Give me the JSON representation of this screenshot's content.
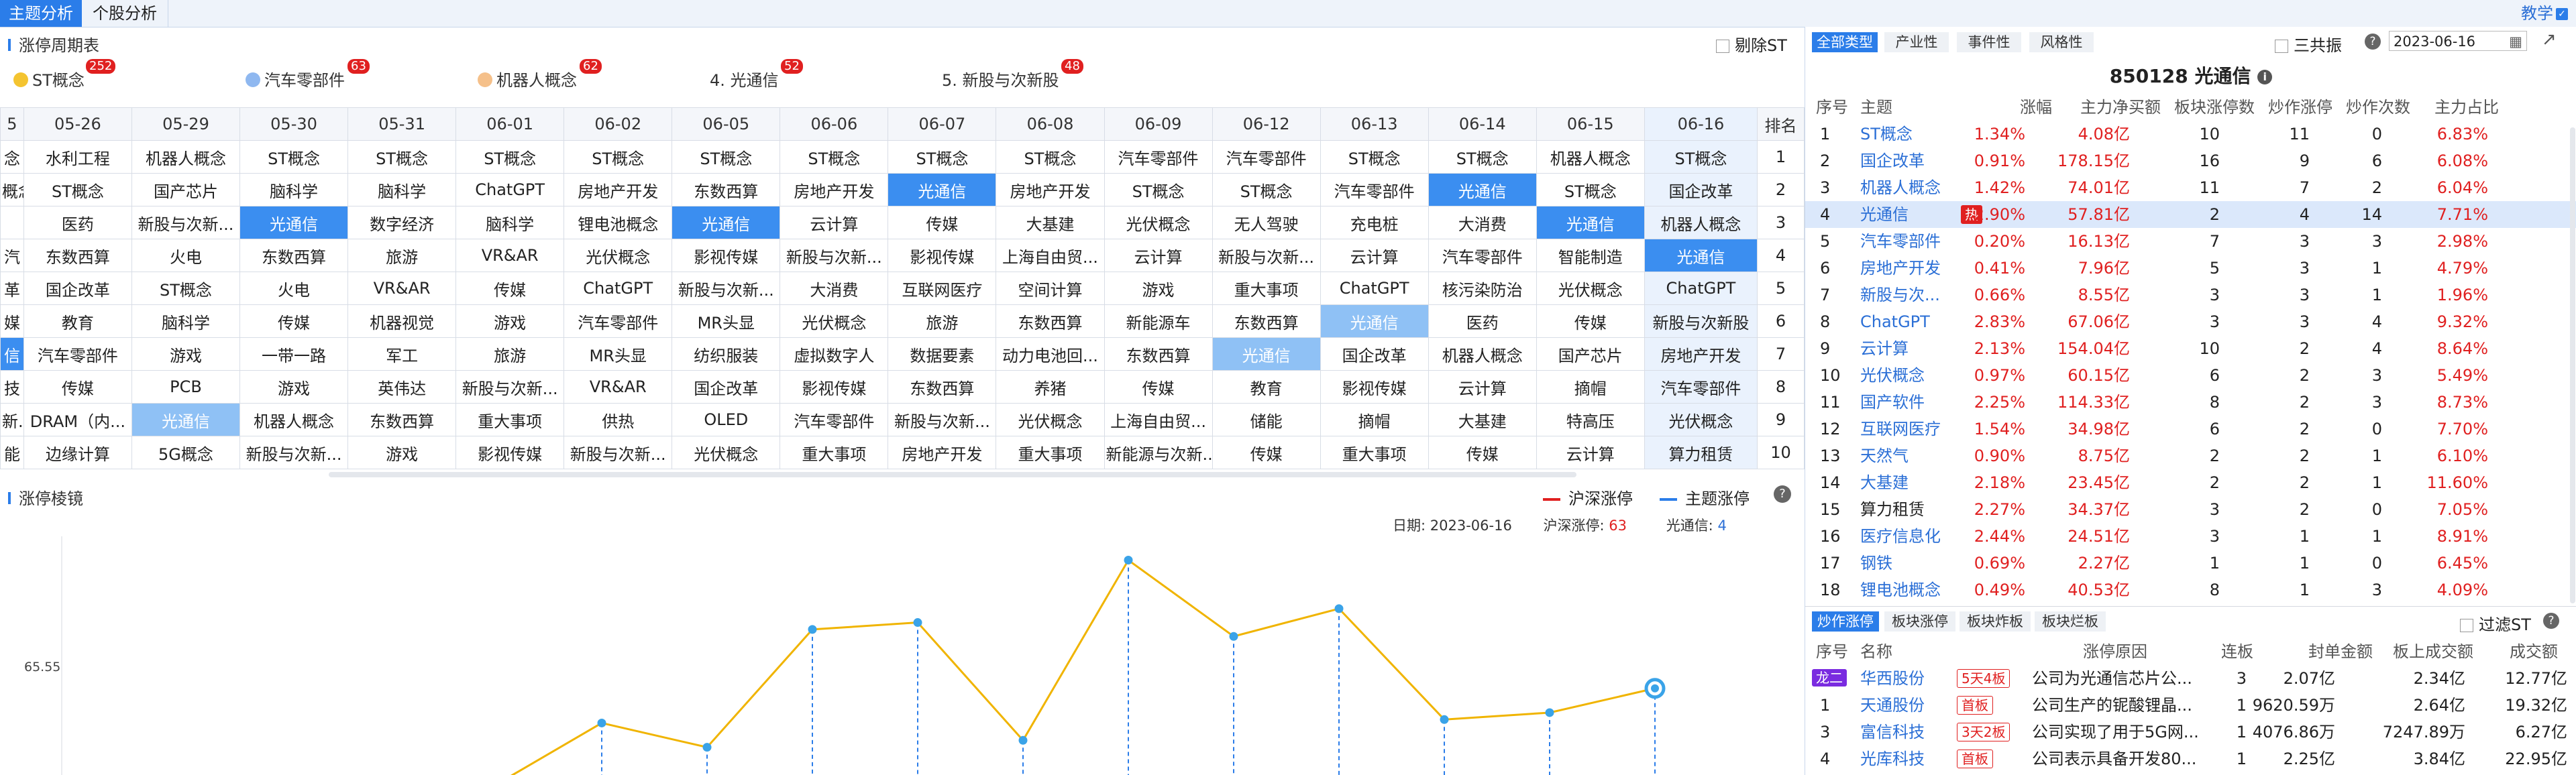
{
  "top_tabs": [
    "主题分析",
    "个股分析"
  ],
  "teach_label": "教学",
  "cycle_table": {
    "title": "涨停周期表",
    "exclude_st_label": "剔除ST",
    "legend": [
      {
        "label": "ST概念",
        "count": "252",
        "dot": "#f4c430"
      },
      {
        "label": "汽车零部件",
        "count": "63",
        "dot": "#8fb8f0"
      },
      {
        "label": "机器人概念",
        "count": "62",
        "dot": "#f5c08a"
      },
      {
        "label": "4. 光通信",
        "count": "52"
      },
      {
        "label": "5. 新股与次新股",
        "count": "48"
      }
    ],
    "dates": [
      "5",
      "05-26",
      "05-29",
      "05-30",
      "05-31",
      "06-01",
      "06-02",
      "06-05",
      "06-06",
      "06-07",
      "06-08",
      "06-09",
      "06-12",
      "06-13",
      "06-14",
      "06-15",
      "06-16"
    ],
    "rank_header": "排名",
    "rows": [
      [
        "念",
        "水利工程",
        "机器人概念",
        "ST概念",
        "ST概念",
        "ST概念",
        "ST概念",
        "ST概念",
        "ST概念",
        "ST概念",
        "ST概念",
        "汽车零部件",
        "汽车零部件",
        "ST概念",
        "ST概念",
        "机器人概念",
        "ST概念"
      ],
      [
        "概念",
        "ST概念",
        "国产芯片",
        "脑科学",
        "脑科学",
        "ChatGPT",
        "房地产开发",
        "东数西算",
        "房地产开发",
        "光通信",
        "房地产开发",
        "ST概念",
        "ST概念",
        "汽车零部件",
        "光通信",
        "ST概念",
        "国企改革"
      ],
      [
        "",
        "医药",
        "新股与次新...",
        "光通信",
        "数字经济",
        "脑科学",
        "锂电池概念",
        "光通信",
        "云计算",
        "传媒",
        "大基建",
        "光伏概念",
        "无人驾驶",
        "充电桩",
        "大消费",
        "光通信",
        "机器人概念"
      ],
      [
        "汽",
        "东数西算",
        "火电",
        "东数西算",
        "旅游",
        "VR&AR",
        "光伏概念",
        "影视传媒",
        "新股与次新...",
        "影视传媒",
        "上海自由贸...",
        "云计算",
        "新股与次新...",
        "云计算",
        "汽车零部件",
        "智能制造",
        "光通信"
      ],
      [
        "革",
        "国企改革",
        "ST概念",
        "火电",
        "VR&AR",
        "传媒",
        "ChatGPT",
        "新股与次新...",
        "大消费",
        "互联网医疗",
        "空间计算",
        "游戏",
        "重大事项",
        "ChatGPT",
        "核污染防治",
        "光伏概念",
        "ChatGPT"
      ],
      [
        "媒",
        "教育",
        "脑科学",
        "传媒",
        "机器视觉",
        "游戏",
        "汽车零部件",
        "MR头显",
        "光伏概念",
        "旅游",
        "东数西算",
        "新能源车",
        "东数西算",
        "光通信",
        "医药",
        "传媒",
        "新股与次新股"
      ],
      [
        "信",
        "汽车零部件",
        "游戏",
        "一带一路",
        "军工",
        "旅游",
        "MR头显",
        "纺织服装",
        "虚拟数字人",
        "数据要素",
        "动力电池回...",
        "东数西算",
        "光通信",
        "国企改革",
        "机器人概念",
        "国产芯片",
        "房地产开发"
      ],
      [
        "技",
        "传媒",
        "PCB",
        "游戏",
        "英伟达",
        "新股与次新...",
        "VR&AR",
        "国企改革",
        "影视传媒",
        "东数西算",
        "养猪",
        "传媒",
        "教育",
        "影视传媒",
        "云计算",
        "摘帽",
        "汽车零部件"
      ],
      [
        "新...",
        "DRAM（内...",
        "光通信",
        "机器人概念",
        "东数西算",
        "重大事项",
        "供热",
        "OLED",
        "汽车零部件",
        "新股与次新...",
        "光伏概念",
        "上海自由贸...",
        "储能",
        "摘帽",
        "大基建",
        "特高压",
        "光伏概念"
      ],
      [
        "能",
        "边缘计算",
        "5G概念",
        "新股与次新...",
        "游戏",
        "影视传媒",
        "新股与次新...",
        "光伏概念",
        "重大事项",
        "房地产开发",
        "重大事项",
        "新能源与次新...",
        "传媒",
        "重大事项",
        "传媒",
        "云计算",
        "算力租赁"
      ]
    ],
    "ranks": [
      "1",
      "2",
      "3",
      "4",
      "5",
      "6",
      "7",
      "8",
      "9",
      "10"
    ],
    "highlight_color": "#3b8ef0",
    "highlight_light_color": "#8fc1f5"
  },
  "limit_chart": {
    "title": "涨停棱镜",
    "legend_hs": "沪深涨停",
    "legend_theme": "主题涨停",
    "date_label": "日期:",
    "date_value": "2023-06-16",
    "hs_label": "沪深涨停:",
    "hs_value": "63",
    "theme_label": "光通信:",
    "theme_value": "4",
    "y_tick": "65.55",
    "hs_color": "#e02020",
    "theme_color": "#2b7de9",
    "line_color": "#f0b400"
  },
  "chart_data": {
    "type": "line",
    "title": "",
    "x": [
      "05-26",
      "05-29",
      "05-30",
      "05-31",
      "06-01",
      "06-02",
      "06-05",
      "06-06",
      "06-07",
      "06-08",
      "06-09",
      "06-12",
      "06-13",
      "06-14",
      "06-15",
      "06-16"
    ],
    "series": [
      {
        "name": "主题涨停",
        "values": [
          null,
          null,
          null,
          null,
          null,
          null,
          55,
          48,
          82,
          84,
          50,
          102,
          80,
          88,
          56,
          58,
          65
        ]
      }
    ],
    "ylabel": "",
    "visible_tick": 65.55
  },
  "right_panel": {
    "tabs": [
      "全部类型",
      "产业性",
      "事件性",
      "风格性"
    ],
    "sanggong_label": "三共振",
    "date_value": "2023-06-16",
    "header_code": "850128 光通信",
    "columns": [
      "序号",
      "主题",
      "涨幅",
      "主力净买额",
      "板块涨停数",
      "炒作涨停",
      "炒作次数",
      "主力占比"
    ],
    "rows": [
      {
        "n": "1",
        "name": "ST概念",
        "pct": "1.34%",
        "buy": "4.08亿",
        "lim": "10",
        "hot": "11",
        "times": "0",
        "ratio": "6.83%"
      },
      {
        "n": "2",
        "name": "国企改革",
        "pct": "0.91%",
        "buy": "178.15亿",
        "lim": "16",
        "hot": "9",
        "times": "6",
        "ratio": "6.08%"
      },
      {
        "n": "3",
        "name": "机器人概念",
        "pct": "1.42%",
        "buy": "74.01亿",
        "lim": "11",
        "hot": "7",
        "times": "2",
        "ratio": "6.04%"
      },
      {
        "n": "4",
        "name": "光通信",
        "pct": "2.90%",
        "buy": "57.81亿",
        "lim": "2",
        "hot": "4",
        "times": "14",
        "ratio": "7.71%",
        "tag": "热"
      },
      {
        "n": "5",
        "name": "汽车零部件",
        "pct": "0.20%",
        "buy": "16.13亿",
        "lim": "7",
        "hot": "3",
        "times": "3",
        "ratio": "2.98%"
      },
      {
        "n": "6",
        "name": "房地产开发",
        "pct": "0.41%",
        "buy": "7.96亿",
        "lim": "5",
        "hot": "3",
        "times": "1",
        "ratio": "4.79%"
      },
      {
        "n": "7",
        "name": "新股与次...",
        "pct": "0.66%",
        "buy": "8.55亿",
        "lim": "3",
        "hot": "3",
        "times": "1",
        "ratio": "1.96%"
      },
      {
        "n": "8",
        "name": "ChatGPT",
        "pct": "2.83%",
        "buy": "67.06亿",
        "lim": "3",
        "hot": "3",
        "times": "4",
        "ratio": "9.32%"
      },
      {
        "n": "9",
        "name": "云计算",
        "pct": "2.13%",
        "buy": "154.04亿",
        "lim": "10",
        "hot": "2",
        "times": "4",
        "ratio": "8.64%"
      },
      {
        "n": "10",
        "name": "光伏概念",
        "pct": "0.97%",
        "buy": "60.15亿",
        "lim": "6",
        "hot": "2",
        "times": "3",
        "ratio": "5.49%"
      },
      {
        "n": "11",
        "name": "国产软件",
        "pct": "2.25%",
        "buy": "114.33亿",
        "lim": "8",
        "hot": "2",
        "times": "3",
        "ratio": "8.73%"
      },
      {
        "n": "12",
        "name": "互联网医疗",
        "pct": "1.54%",
        "buy": "34.98亿",
        "lim": "6",
        "hot": "2",
        "times": "0",
        "ratio": "7.70%"
      },
      {
        "n": "13",
        "name": "天然气",
        "pct": "0.90%",
        "buy": "8.75亿",
        "lim": "2",
        "hot": "2",
        "times": "1",
        "ratio": "6.10%"
      },
      {
        "n": "14",
        "name": "大基建",
        "pct": "2.18%",
        "buy": "23.45亿",
        "lim": "2",
        "hot": "2",
        "times": "1",
        "ratio": "11.60%"
      },
      {
        "n": "15",
        "name": "算力租赁",
        "pct": "2.27%",
        "buy": "34.37亿",
        "lim": "3",
        "hot": "2",
        "times": "0",
        "ratio": "7.05%",
        "black": true
      },
      {
        "n": "16",
        "name": "医疗信息化",
        "pct": "2.44%",
        "buy": "24.51亿",
        "lim": "3",
        "hot": "1",
        "times": "1",
        "ratio": "8.91%"
      },
      {
        "n": "17",
        "name": "钢铁",
        "pct": "0.69%",
        "buy": "2.27亿",
        "lim": "1",
        "hot": "1",
        "times": "0",
        "ratio": "6.45%"
      },
      {
        "n": "18",
        "name": "锂电池概念",
        "pct": "0.49%",
        "buy": "40.53亿",
        "lim": "8",
        "hot": "1",
        "times": "3",
        "ratio": "4.09%"
      }
    ],
    "bottom_tabs": [
      "炒作涨停",
      "板块涨停",
      "板块炸板",
      "板块烂板"
    ],
    "filter_st_label": "过滤ST",
    "bottom_columns": [
      "序号",
      "名称",
      "涨停原因",
      "连板",
      "封单金额",
      "板上成交额",
      "成交额"
    ],
    "stocks": [
      {
        "n": "龙二",
        "name": "华西股份",
        "tag": "5天4板",
        "reason": "公司为光通信芯片公...",
        "lb": "3",
        "seal": "2.07亿",
        "onboard": "2.34亿",
        "amount": "12.77亿"
      },
      {
        "n": "1",
        "name": "天通股份",
        "tag": "首板",
        "reason": "公司生产的铌酸锂晶...",
        "lb": "1",
        "seal": "9620.59万",
        "onboard": "2.64亿",
        "amount": "19.32亿"
      },
      {
        "n": "3",
        "name": "富信科技",
        "tag": "3天2板",
        "reason": "公司实现了用于5G网...",
        "lb": "1",
        "seal": "4076.86万",
        "onboard": "7247.89万",
        "amount": "6.27亿"
      },
      {
        "n": "4",
        "name": "光库科技",
        "tag": "首板",
        "reason": "公司表示具备开发80...",
        "lb": "1",
        "seal": "2.25亿",
        "onboard": "3.84亿",
        "amount": "22.95亿"
      }
    ]
  }
}
